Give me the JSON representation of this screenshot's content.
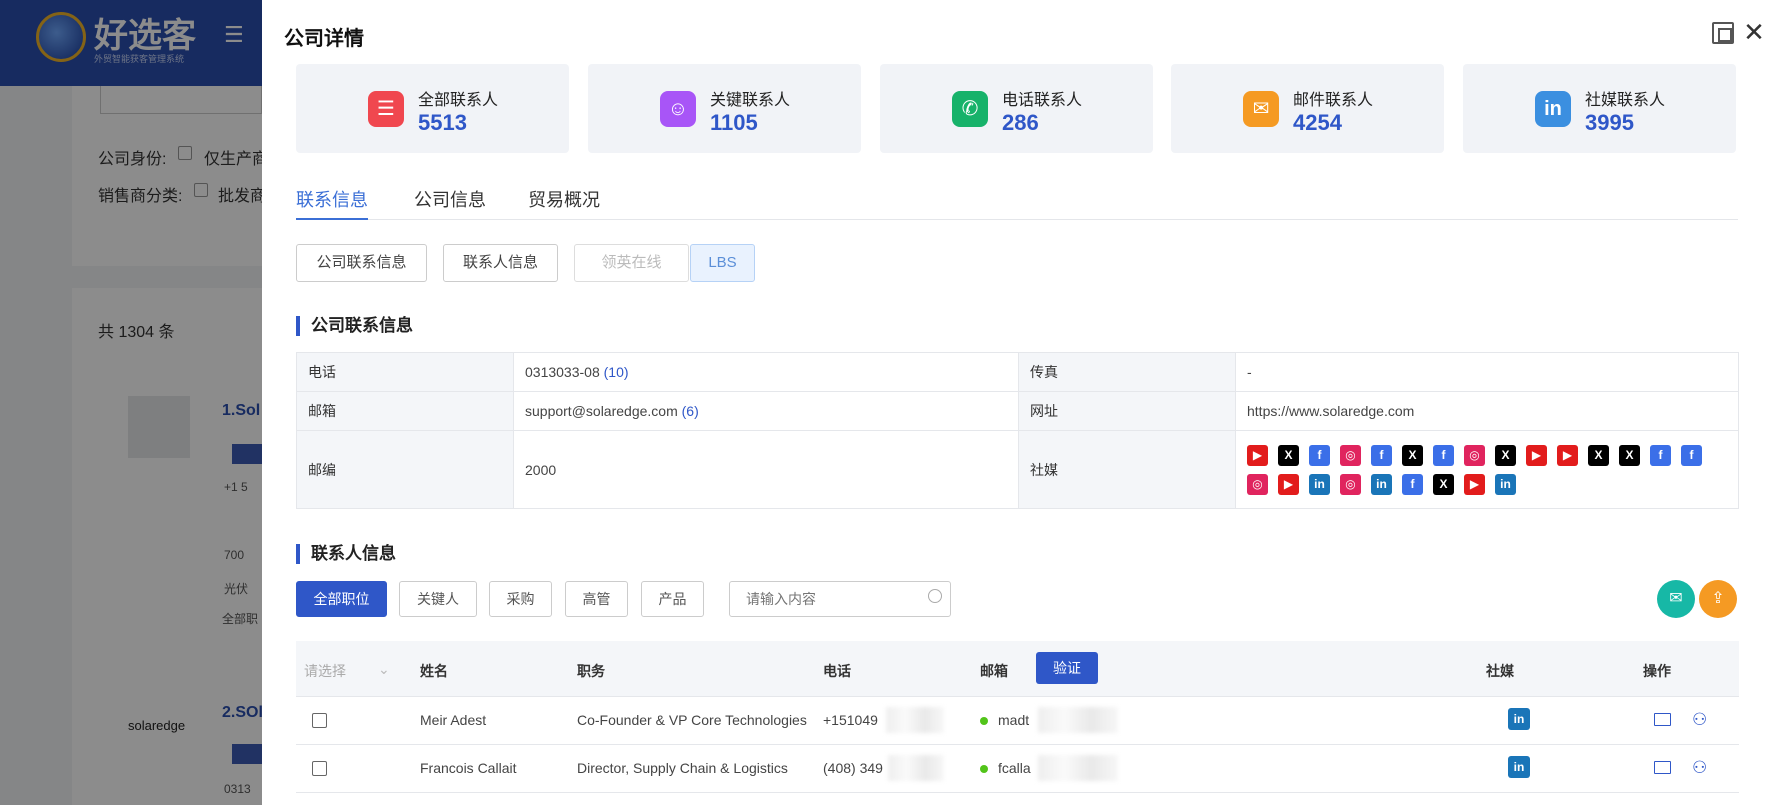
{
  "background": {
    "logo_text": "好选客",
    "logo_sub": "外贸智能获客管理系统",
    "menu_glyph": "☰",
    "company_identity_label": "公司身份:",
    "company_identity_option": "仅生产商",
    "distributor_label": "销售商分类:",
    "distributor_option": "批发商",
    "total": "共 1304 条",
    "result1_name": "1.Sol",
    "result1_phone": "+1 5",
    "result1_addr": "700",
    "result1_type": "光伏",
    "result1_pos": "全部职",
    "result2_name": "2.SOl",
    "result2_logo": "solaredge",
    "result2_phone": "0313"
  },
  "drawer": {
    "title": "公司详情",
    "close_glyph": "✕"
  },
  "stats": [
    {
      "label": "全部联系人",
      "value": "5513",
      "icon": "contacts-card-icon",
      "color": "#f0474f",
      "glyph": "☰"
    },
    {
      "label": "关键联系人",
      "value": "1105",
      "icon": "key-person-icon",
      "color": "#a855f7",
      "glyph": "☺"
    },
    {
      "label": "电话联系人",
      "value": "286",
      "icon": "phone-icon",
      "color": "#17b26a",
      "glyph": "✆"
    },
    {
      "label": "邮件联系人",
      "value": "4254",
      "icon": "mail-icon",
      "color": "#f59a23",
      "glyph": "✉"
    },
    {
      "label": "社媒联系人",
      "value": "3995",
      "icon": "linkedin-icon",
      "color": "#3b8fe0",
      "glyph": "in"
    }
  ],
  "tabs": [
    "联系信息",
    "公司信息",
    "贸易概况"
  ],
  "sub_buttons": [
    "公司联系信息",
    "联系人信息",
    "领英在线",
    "LBS"
  ],
  "company_contact": {
    "section_title": "公司联系信息",
    "phone_label": "电话",
    "phone_value": "0313033-08",
    "phone_count": "(10)",
    "fax_label": "传真",
    "fax_value": "-",
    "email_label": "邮箱",
    "email_value": "support@solaredge.com",
    "email_count": "(6)",
    "website_label": "网址",
    "website_value": "https://www.solaredge.com",
    "zip_label": "邮编",
    "zip_value": "2000",
    "social_label": "社媒",
    "social_icons": [
      "youtube",
      "x",
      "facebook",
      "instagram",
      "facebook",
      "x",
      "facebook",
      "instagram",
      "x",
      "youtube",
      "youtube",
      "x",
      "x",
      "facebook",
      "facebook",
      "instagram",
      "youtube",
      "linkedin",
      "instagram",
      "linkedin",
      "facebook",
      "x",
      "youtube",
      "linkedin"
    ]
  },
  "contacts": {
    "section_title": "联系人信息",
    "filters": [
      "全部职位",
      "关键人",
      "采购",
      "高管",
      "产品"
    ],
    "search_placeholder": "请输入内容",
    "columns": {
      "select": "请选择",
      "name": "姓名",
      "title": "职务",
      "phone": "电话",
      "email": "邮箱",
      "verify": "验证",
      "social": "社媒",
      "ops": "操作"
    },
    "rows": [
      {
        "name": "Meir Adest",
        "title": "Co-Founder & VP Core Technologies",
        "phone": "+151049",
        "email": "madt"
      },
      {
        "name": "Francois Callait",
        "title": "Director, Supply Chain & Logistics",
        "phone": "(408) 349",
        "email": "fcalla"
      }
    ]
  }
}
